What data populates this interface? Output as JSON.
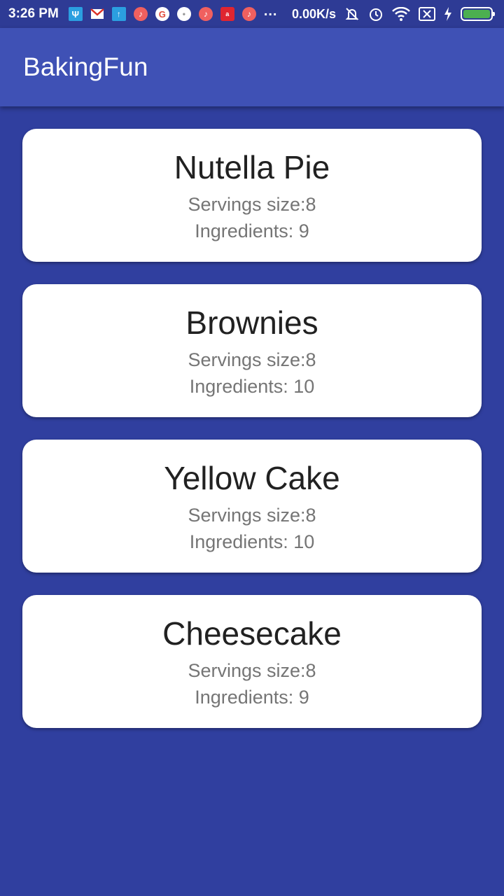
{
  "status_bar": {
    "time": "3:26 PM",
    "net_speed": "0.00K/s",
    "notification_icons": [
      "usb-icon",
      "gmail-icon",
      "upload-icon",
      "music-icon",
      "google-icon",
      "notification-icon",
      "music-icon",
      "airtel-icon",
      "music-icon"
    ],
    "ellipsis": "...",
    "battery_level": 1.0,
    "battery_color": "#4CAF50"
  },
  "app_bar": {
    "title": "BakingFun",
    "color": "#3F51B5"
  },
  "background_color": "#303F9F",
  "recipes": [
    {
      "name": "Nutella Pie",
      "servings": "Servings size:8",
      "ingredients": "Ingredients: 9"
    },
    {
      "name": "Brownies",
      "servings": "Servings size:8",
      "ingredients": "Ingredients: 10"
    },
    {
      "name": "Yellow Cake",
      "servings": "Servings size:8",
      "ingredients": "Ingredients: 10"
    },
    {
      "name": "Cheesecake",
      "servings": "Servings size:8",
      "ingredients": "Ingredients: 9"
    }
  ]
}
